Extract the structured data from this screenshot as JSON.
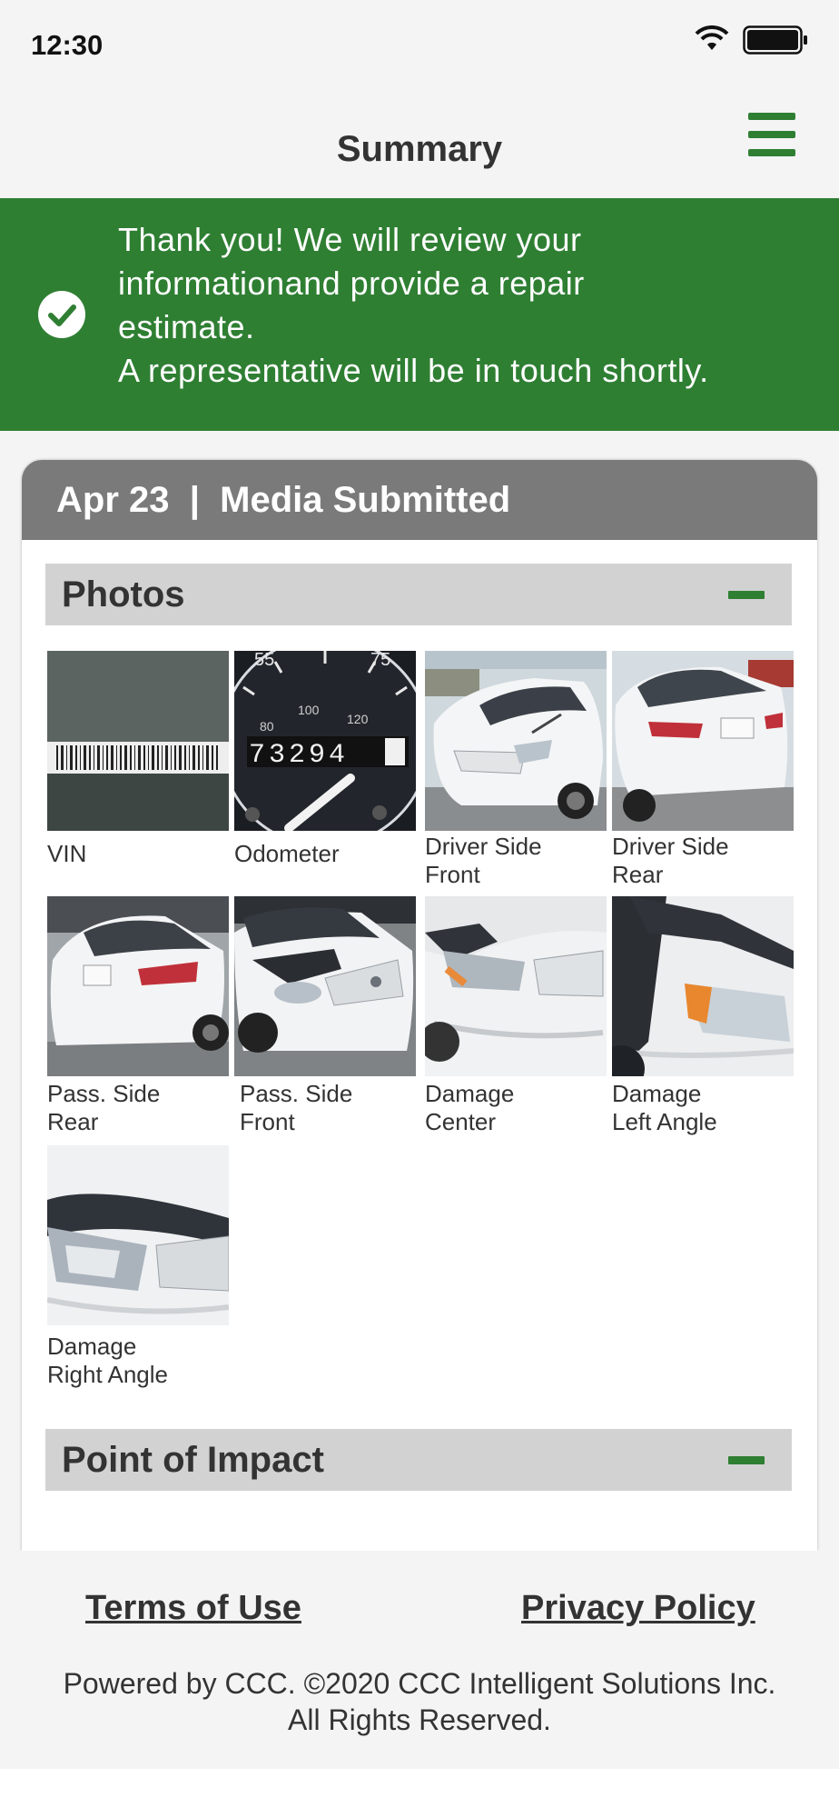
{
  "status_bar": {
    "time": "12:30"
  },
  "nav": {
    "title": "Summary",
    "menu_icon": "hamburger-menu-icon"
  },
  "banner": {
    "lines": [
      "Thank you! We will review your",
      "informationand provide a repair",
      "estimate.",
      "A representative will be in touch shortly."
    ],
    "icon": "check-circle-icon",
    "color": "#2f7f33"
  },
  "card": {
    "header": "Apr 23  |  Media Submitted",
    "photos_section": {
      "title": "Photos",
      "items": [
        {
          "label_lines": [
            "VIN"
          ],
          "thumb": "vin-photo"
        },
        {
          "label_lines": [
            "Odometer"
          ],
          "thumb": "odometer-photo",
          "reading": "73294"
        },
        {
          "label_lines": [
            "Driver Side",
            "Front"
          ],
          "thumb": "driver-side-front-photo"
        },
        {
          "label_lines": [
            "Driver Side",
            "Rear"
          ],
          "thumb": "driver-side-rear-photo"
        },
        {
          "label_lines": [
            "Pass. Side",
            "Rear"
          ],
          "thumb": "pass-side-rear-photo"
        },
        {
          "label_lines": [
            "Pass. Side",
            "Front"
          ],
          "thumb": "pass-side-front-photo"
        },
        {
          "label_lines": [
            "Damage",
            "Center"
          ],
          "thumb": "damage-center-photo"
        },
        {
          "label_lines": [
            "Damage",
            "Left Angle"
          ],
          "thumb": "damage-left-angle-photo"
        },
        {
          "label_lines": [
            "Damage",
            "Right Angle"
          ],
          "thumb": "damage-right-angle-photo"
        }
      ]
    },
    "impact_section": {
      "title": "Point of Impact"
    }
  },
  "footer": {
    "terms": "Terms of Use",
    "privacy": "Privacy Policy",
    "copyright_lines": [
      "Powered by CCC. ©2020 CCC Intelligent Solutions Inc.",
      "All Rights Reserved."
    ]
  },
  "colors": {
    "accent": "#2f7f33",
    "header_gray": "#7a7a7a",
    "section_gray": "#d2d2d2"
  }
}
